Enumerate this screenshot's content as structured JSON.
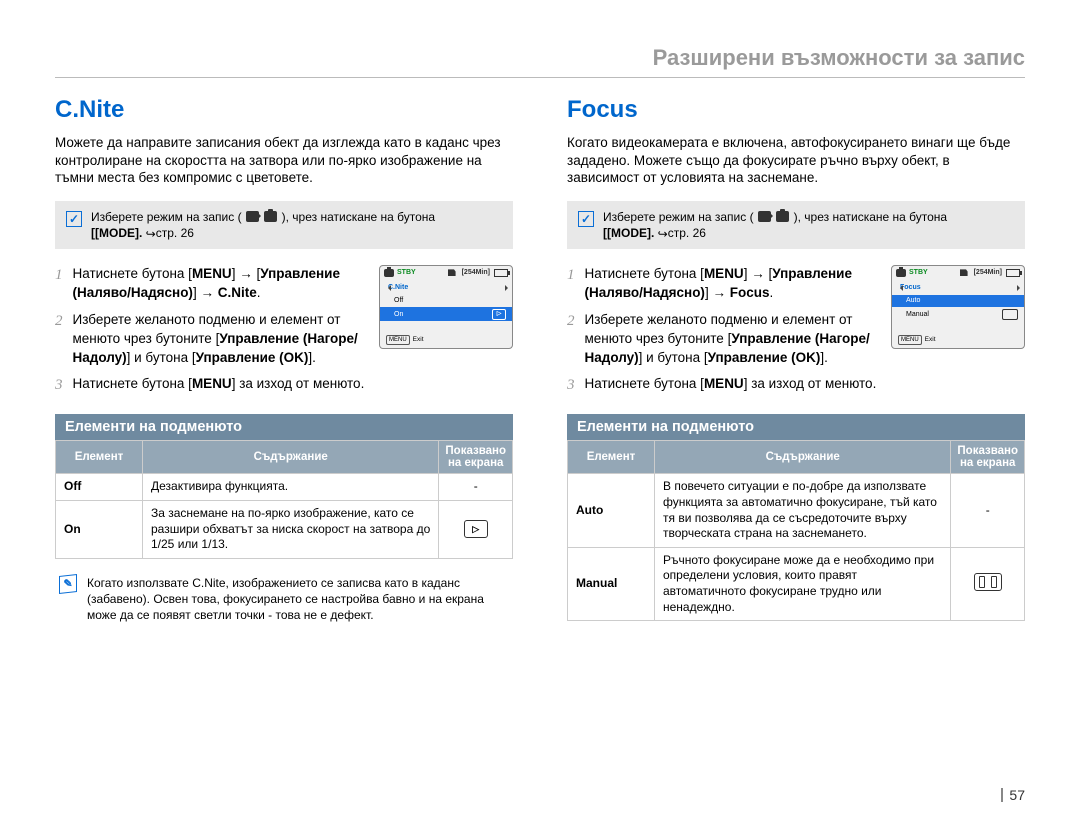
{
  "chapter_title": "Разширени възможности за запис",
  "page_number": "57",
  "tip_common": {
    "text_a": "Изберете режим на запис (",
    "text_b": "), чрез натискане на бутона",
    "text_c": "[MODE]. ",
    "text_d": "стр. 26"
  },
  "cnite": {
    "title": "C.Nite",
    "intro": "Можете да направите записания обект да изглежда като в каданс чрез контролиране на скоростта на затвора или по-ярко изображение на тъмни места без компромис с цветовете.",
    "step1_a": "Натиснете бутона [",
    "step1_menu": "MENU",
    "step1_b": "] → [",
    "step1_ctrl": "Управление (Наляво/Надясно)",
    "step1_c": "] → ",
    "step1_target": "C.Nite",
    "step1_d": ".",
    "step2_a": "Изберете желаното подменю и елемент от менюто чрез бутоните [",
    "step2_ctrl": "Управление (Нагоре/Надолу)",
    "step2_b": "] и бутона [",
    "step2_ok": "Управление (OK)",
    "step2_c": "].",
    "step3_a": "Натиснете бутона [",
    "step3_menu": "MENU",
    "step3_b": "] за изход от менюто.",
    "screenshot": {
      "stby": "STBY",
      "time": "[254Min]",
      "menu_title": "C.Nite",
      "row_off": "Off",
      "row_on": "On",
      "exit_btn": "MENU",
      "exit_label": "Exit"
    },
    "table_heading": "Елементи на подменюто",
    "headers": {
      "h1": "Елемент",
      "h2": "Съдържание",
      "h3": "Показвано на екрана"
    },
    "rows": {
      "off_label": "Off",
      "off_desc": "Дезактивира функцията.",
      "off_icon": "-",
      "on_label": "On",
      "on_desc": "За заснемане на по-ярко изображение, като се разшири обхватът за ниска скорост на затвора до 1/25 или 1/13.",
      "on_icon_glyph": "▷"
    },
    "note": "Когато използвате C.Nite, изображението се записва като в каданс (забавено). Освен това, фокусирането се настройва бавно и на екрана може да се появят светли точки - това не е дефект."
  },
  "focus": {
    "title": "Focus",
    "intro": "Когато видеокамерата е включена, автофокусирането винаги ще бъде зададено. Можете също да фокусирате ръчно върху обект, в зависимост от условията на заснемане.",
    "step1_a": "Натиснете бутона [",
    "step1_menu": "MENU",
    "step1_b": "] → [",
    "step1_ctrl": "Управление (Наляво/Надясно)",
    "step1_c": "] → ",
    "step1_target": "Focus",
    "step1_d": ".",
    "step2_a": "Изберете желаното подменю и елемент от менюто чрез бутоните [",
    "step2_ctrl": "Управление (Нагоре/Надолу)",
    "step2_b": "] и бутона [",
    "step2_ok": "Управление (OK)",
    "step2_c": "].",
    "step3_a": "Натиснете бутона [",
    "step3_menu": "MENU",
    "step3_b": "] за изход от менюто.",
    "screenshot": {
      "stby": "STBY",
      "time": "[254Min]",
      "menu_title": "Focus",
      "row_auto": "Auto",
      "row_manual": "Manual",
      "exit_btn": "MENU",
      "exit_label": "Exit"
    },
    "table_heading": "Елементи на подменюто",
    "headers": {
      "h1": "Елемент",
      "h2": "Съдържание",
      "h3": "Показвано на екрана"
    },
    "rows": {
      "auto_label": "Auto",
      "auto_desc": "В повечето ситуации е по-добре да използвате функцията за автоматично фокусиране, тъй като тя ви позволява да се съсредоточите върху творческата страна на заснемането.",
      "auto_icon": "-",
      "manual_label": "Manual",
      "manual_desc": "Ръчното фокусиране може да е необходимо при определени условия, които правят автоматичното фокусиране трудно или ненадеждно."
    }
  }
}
